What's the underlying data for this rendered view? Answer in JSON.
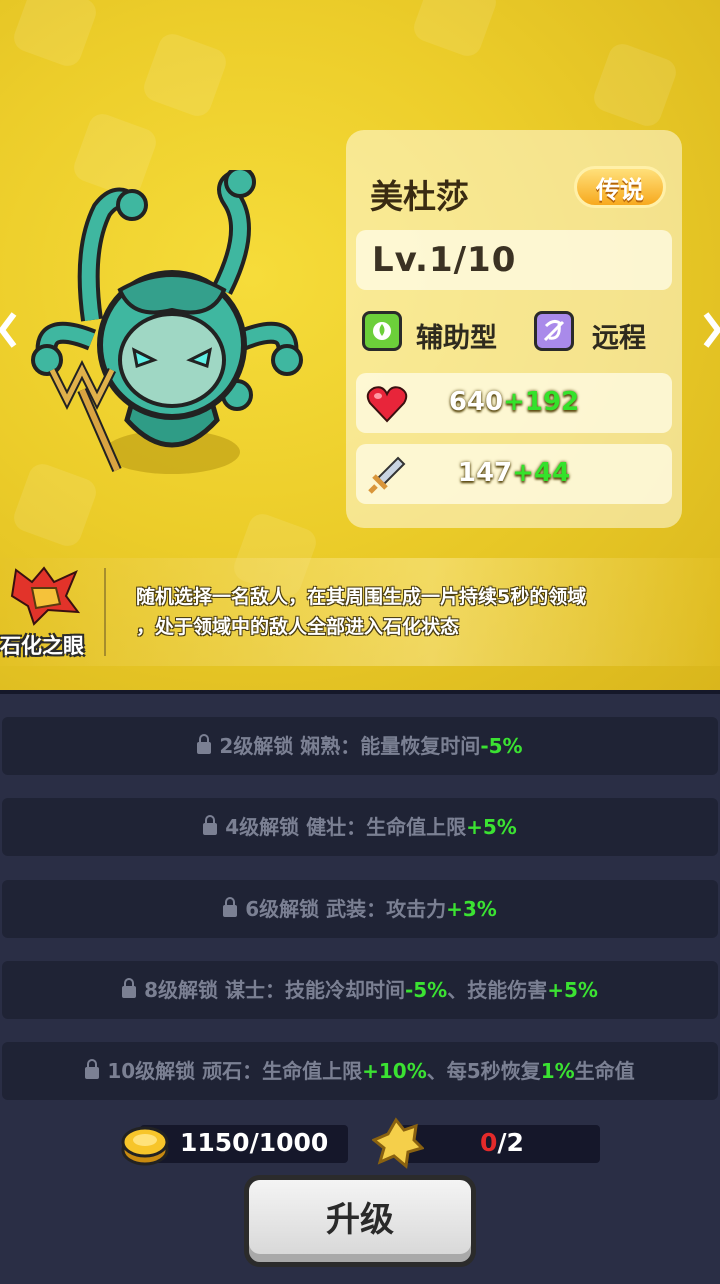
{
  "hero": {
    "name": "美杜莎",
    "rarity": "传说",
    "level": "Lv.1/10",
    "type_label": "辅助型",
    "range_label": "远程",
    "hp_base": "640",
    "hp_bonus": "+192",
    "atk_base": "147",
    "atk_bonus": "+44"
  },
  "skill": {
    "name": "石化之眼",
    "description": "随机选择一名敌人，在其周围生成一片持续5秒的领域\n，处于领域中的敌人全部进入石化状态"
  },
  "unlocks": [
    {
      "prefix": "2级解锁 娴熟：能量恢复时间",
      "value": "-5%"
    },
    {
      "prefix": "4级解锁 健壮：生命值上限",
      "value": "+5%"
    },
    {
      "prefix": "6级解锁 武装：攻击力",
      "value": "+3%"
    },
    {
      "prefix": "8级解锁 谋士：技能冷却时间",
      "value": "-5%",
      "mid": "、技能伤害",
      "value2": "+5%"
    },
    {
      "prefix": "10级解锁 顽石：生命值上限",
      "value": "+10%",
      "mid": "、每5秒恢复",
      "value2": "1%",
      "suffix": "生命值"
    }
  ],
  "resources": {
    "gold": "1150/1000",
    "shards_current": "0",
    "shards_total": "/2"
  },
  "upgrade_button": "升级",
  "colors": {
    "background_top": "#eccd2a",
    "background_bottom": "#2a2e45",
    "bonus_green": "#34e22b",
    "shard_red": "#e42a2a"
  },
  "icons": [
    "arrow-left-icon",
    "arrow-right-icon",
    "support-type-icon",
    "bow-range-icon",
    "heart-icon",
    "sword-icon",
    "skill-petrify-icon",
    "lock-icon",
    "gold-coin-icon",
    "hero-shard-icon"
  ]
}
